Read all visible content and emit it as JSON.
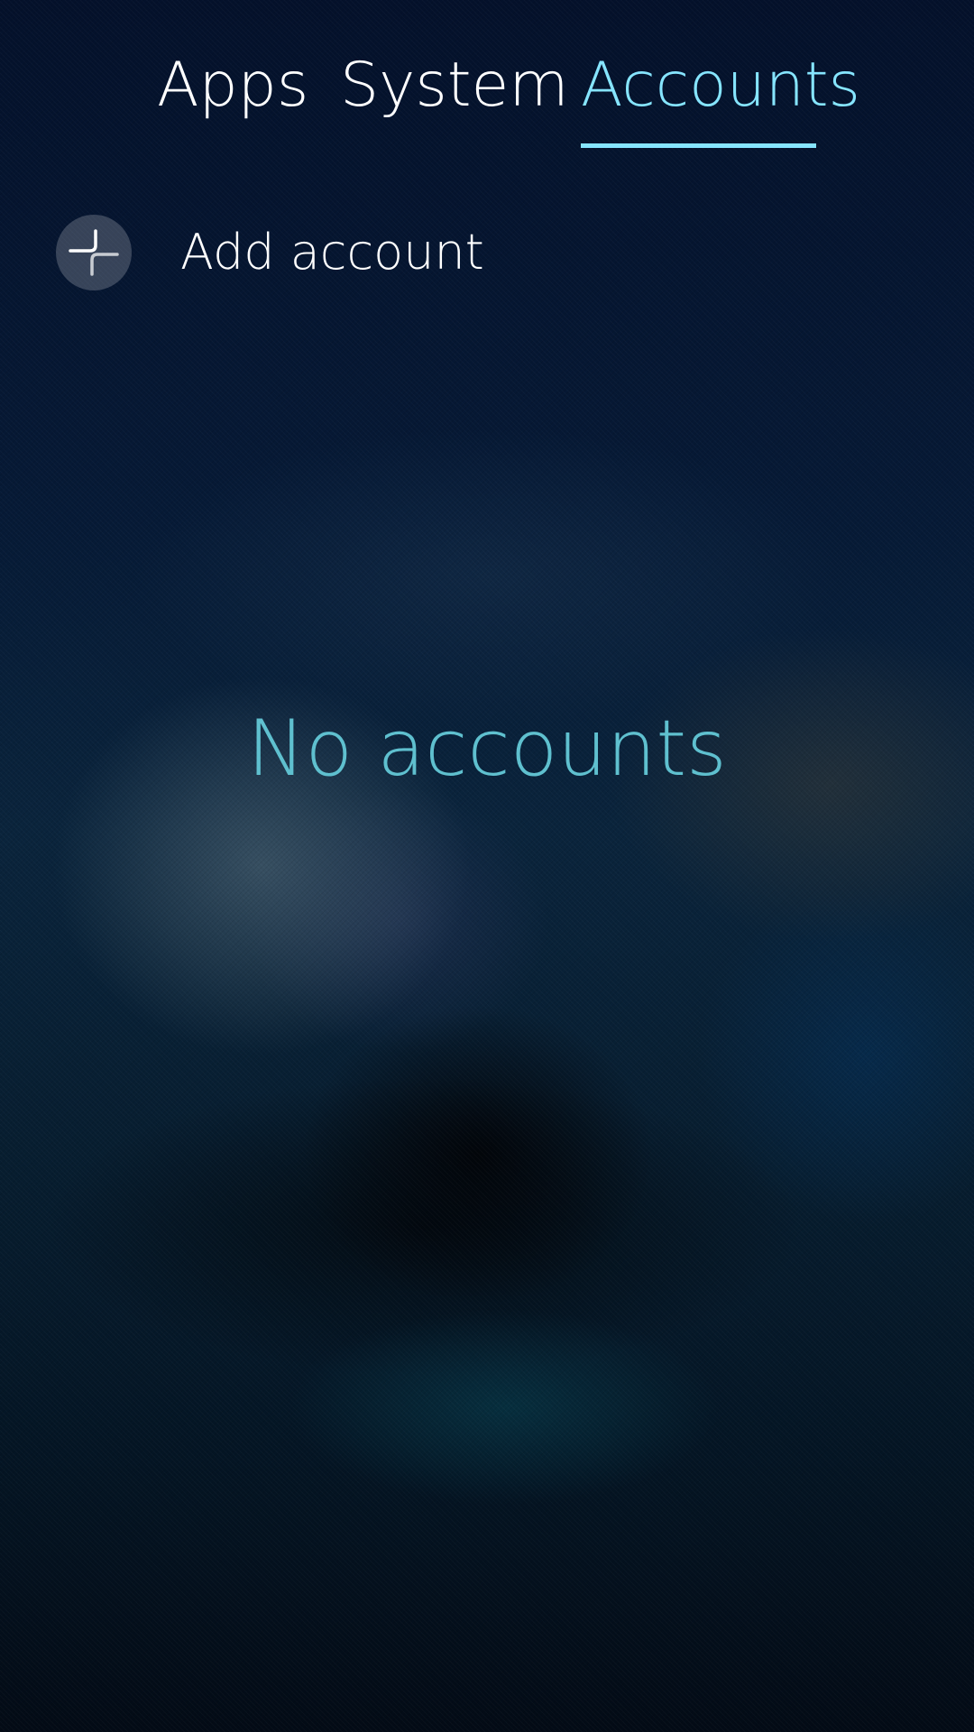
{
  "tabs": [
    {
      "label": "Apps",
      "active": false
    },
    {
      "label": "System",
      "active": false
    },
    {
      "label": "Accounts",
      "active": true
    }
  ],
  "accent_color": "#86e5ff",
  "add_account": {
    "label": "Add account",
    "icon": "add-icon"
  },
  "empty_state": {
    "text": "No accounts",
    "color": "#5fc0cf"
  }
}
